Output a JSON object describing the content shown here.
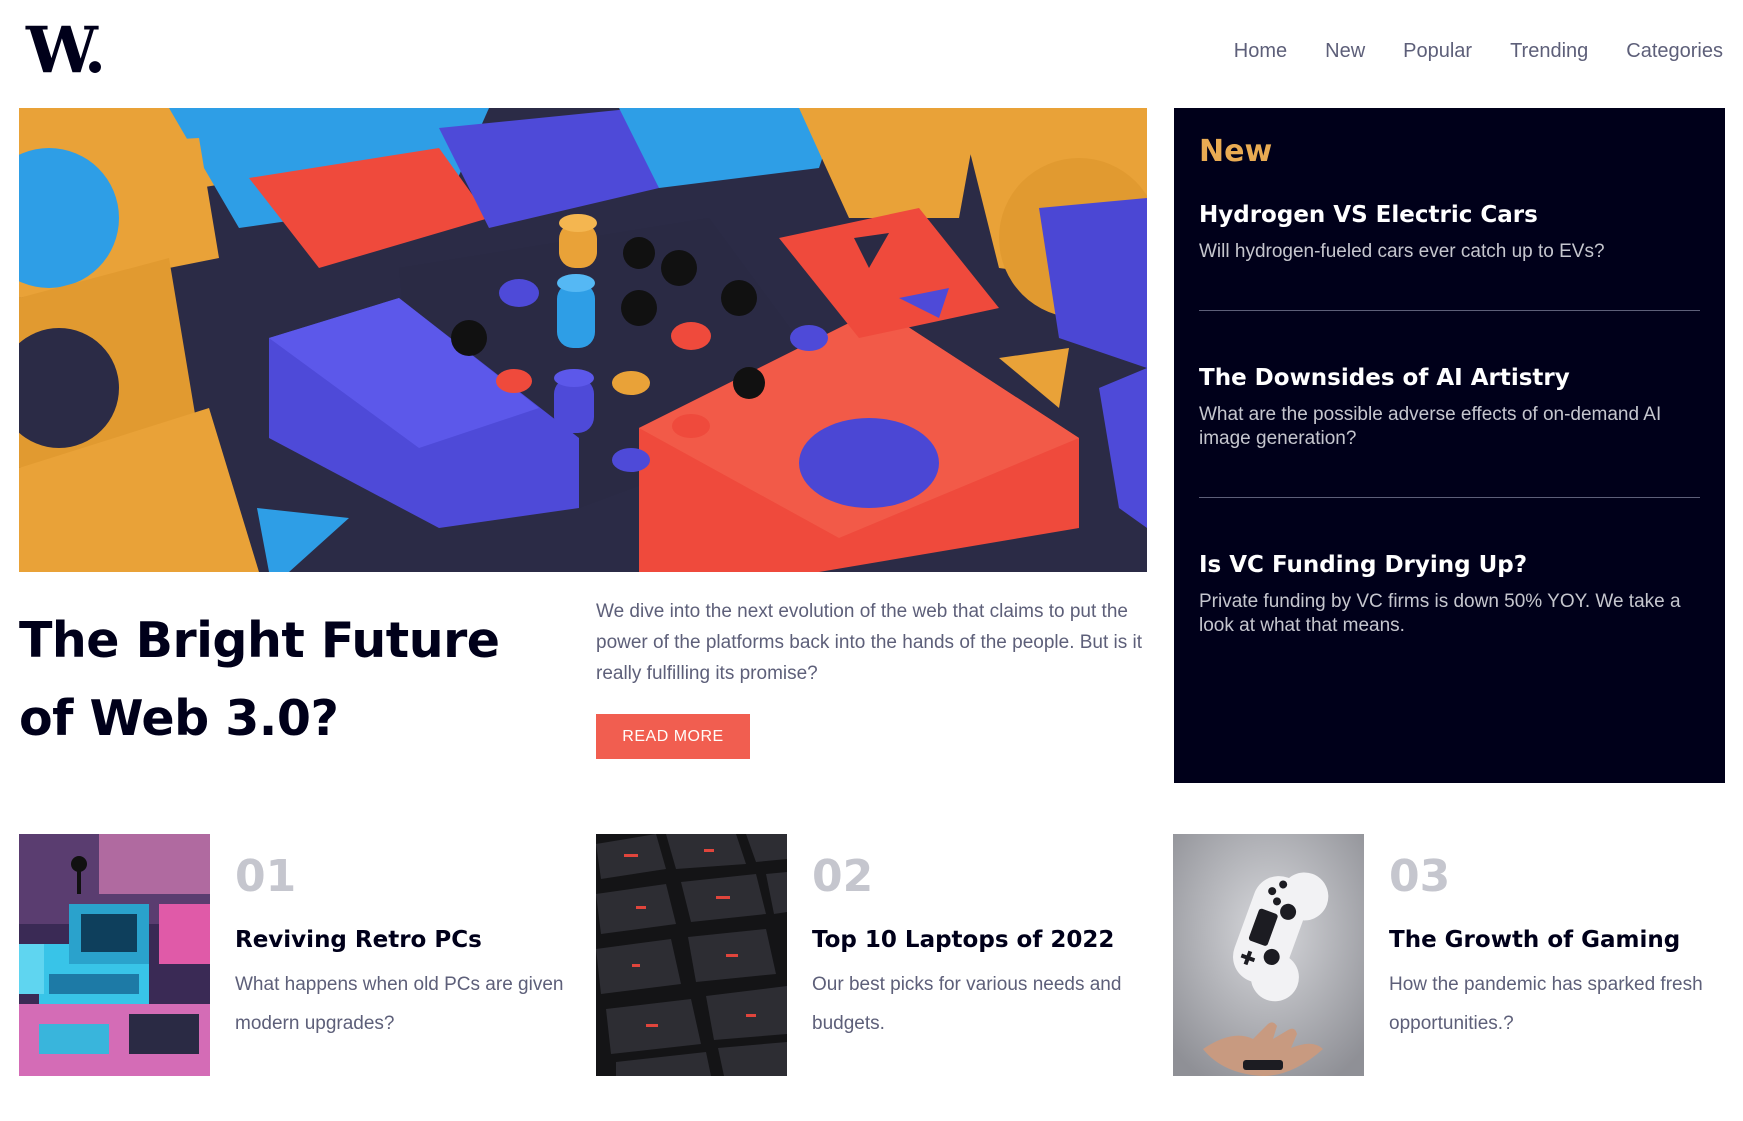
{
  "brand": {
    "logo_text": "W."
  },
  "nav": {
    "items": [
      {
        "label": "Home"
      },
      {
        "label": "New"
      },
      {
        "label": "Popular"
      },
      {
        "label": "Trending"
      },
      {
        "label": "Categories"
      }
    ]
  },
  "hero": {
    "title": "The Bright Future of Web 3.0?",
    "description": "We dive into the next evolution of the web that claims to put the power of the platforms back into the hands of the people. But is it really fulfilling its promise?",
    "button_label": "READ MORE"
  },
  "new_panel": {
    "heading": "New",
    "items": [
      {
        "title": "Hydrogen VS Electric Cars",
        "description": "Will hydrogen-fueled cars ever catch up to EVs?"
      },
      {
        "title": "The Downsides of AI Artistry",
        "description": "What are the possible adverse effects of on-demand AI image generation?"
      },
      {
        "title": "Is VC Funding Drying Up?",
        "description": "Private funding by VC firms is down 50% YOY. We take a look at what that means."
      }
    ]
  },
  "cards": [
    {
      "number": "01",
      "title": "Reviving Retro PCs",
      "description": "What happens when old PCs are given modern upgrades?"
    },
    {
      "number": "02",
      "title": "Top 10 Laptops of 2022",
      "description": "Our best picks for various needs and budgets."
    },
    {
      "number": "03",
      "title": "The Growth of Gaming",
      "description": "How the pandemic has sparked fresh opportunities.?"
    }
  ],
  "colors": {
    "dark_blue": "#00001a",
    "soft_orange": "#e9ab53",
    "soft_red": "#f15e50",
    "grayish_blue": "#5d5f79",
    "off_white": "#fffdfa"
  }
}
